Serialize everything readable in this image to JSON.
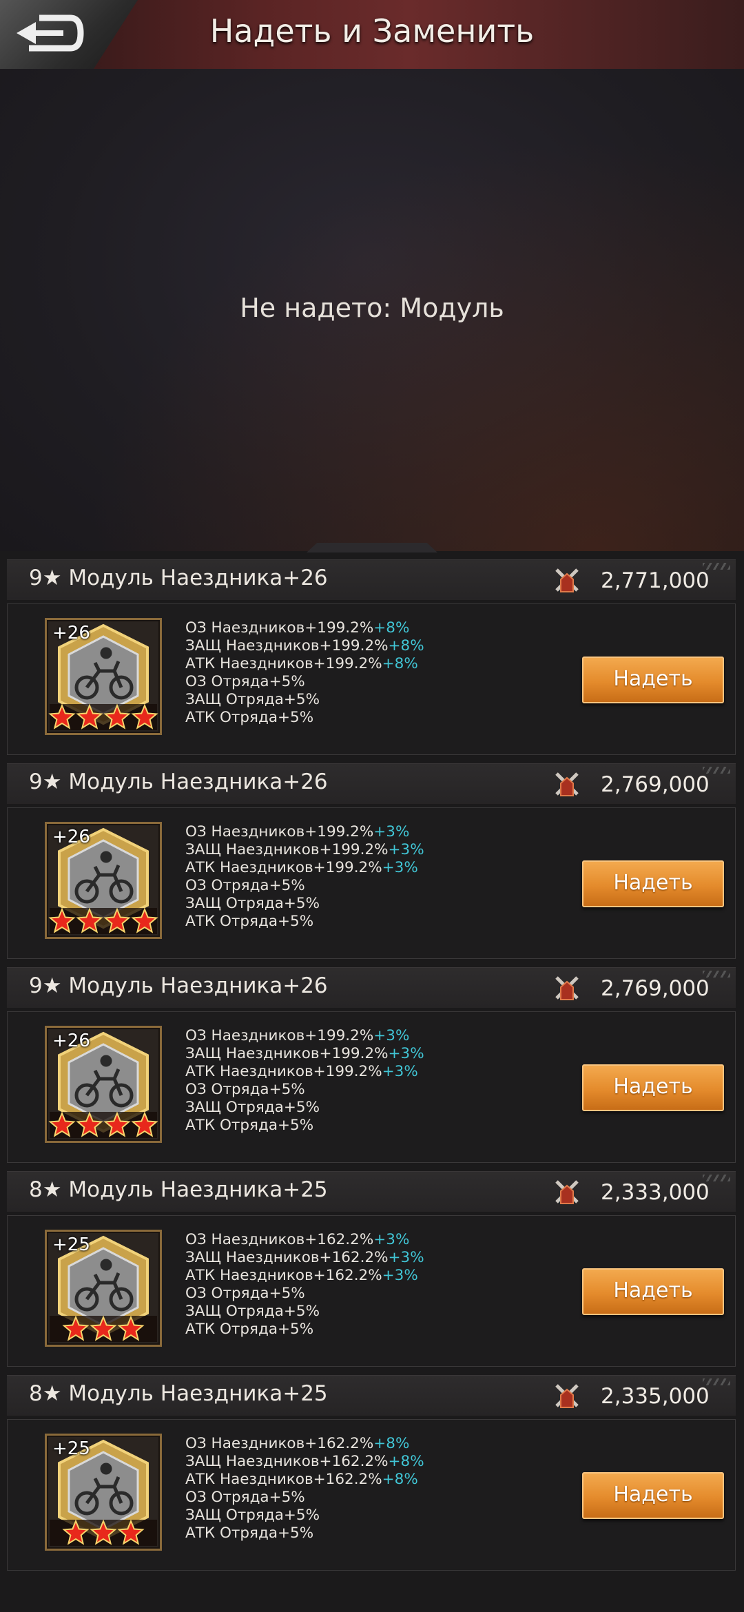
{
  "header": {
    "title": "Надеть и Заменить"
  },
  "preview": {
    "empty_text": "Не надето: Модуль"
  },
  "colors": {
    "accent": "#e48b2c",
    "bonus": "#41c6d6"
  },
  "items": [
    {
      "name": "9★ Модуль Наездника+26",
      "power": "2,771,000",
      "level": "+26",
      "stars": 4,
      "stats": [
        {
          "text": "ОЗ Наездников+199.2%",
          "bonus": "+8%"
        },
        {
          "text": "ЗАЩ Наездников+199.2%",
          "bonus": "+8%"
        },
        {
          "text": "АТК Наездников+199.2%",
          "bonus": "+8%"
        },
        {
          "text": "ОЗ Отряда+5%",
          "bonus": ""
        },
        {
          "text": "ЗАЩ Отряда+5%",
          "bonus": ""
        },
        {
          "text": "АТК Отряда+5%",
          "bonus": ""
        }
      ],
      "button": "Надеть"
    },
    {
      "name": "9★ Модуль Наездника+26",
      "power": "2,769,000",
      "level": "+26",
      "stars": 4,
      "stats": [
        {
          "text": "ОЗ Наездников+199.2%",
          "bonus": "+3%"
        },
        {
          "text": "ЗАЩ Наездников+199.2%",
          "bonus": "+3%"
        },
        {
          "text": "АТК Наездников+199.2%",
          "bonus": "+3%"
        },
        {
          "text": "ОЗ Отряда+5%",
          "bonus": ""
        },
        {
          "text": "ЗАЩ Отряда+5%",
          "bonus": ""
        },
        {
          "text": "АТК Отряда+5%",
          "bonus": ""
        }
      ],
      "button": "Надеть"
    },
    {
      "name": "9★ Модуль Наездника+26",
      "power": "2,769,000",
      "level": "+26",
      "stars": 4,
      "stats": [
        {
          "text": "ОЗ Наездников+199.2%",
          "bonus": "+3%"
        },
        {
          "text": "ЗАЩ Наездников+199.2%",
          "bonus": "+3%"
        },
        {
          "text": "АТК Наездников+199.2%",
          "bonus": "+3%"
        },
        {
          "text": "ОЗ Отряда+5%",
          "bonus": ""
        },
        {
          "text": "ЗАЩ Отряда+5%",
          "bonus": ""
        },
        {
          "text": "АТК Отряда+5%",
          "bonus": ""
        }
      ],
      "button": "Надеть"
    },
    {
      "name": "8★ Модуль Наездника+25",
      "power": "2,333,000",
      "level": "+25",
      "stars": 3,
      "stats": [
        {
          "text": "ОЗ Наездников+162.2%",
          "bonus": "+3%"
        },
        {
          "text": "ЗАЩ Наездников+162.2%",
          "bonus": "+3%"
        },
        {
          "text": "АТК Наездников+162.2%",
          "bonus": "+3%"
        },
        {
          "text": "ОЗ Отряда+5%",
          "bonus": ""
        },
        {
          "text": "ЗАЩ Отряда+5%",
          "bonus": ""
        },
        {
          "text": "АТК Отряда+5%",
          "bonus": ""
        }
      ],
      "button": "Надеть"
    },
    {
      "name": "8★ Модуль Наездника+25",
      "power": "2,335,000",
      "level": "+25",
      "stars": 3,
      "stats": [
        {
          "text": "ОЗ Наездников+162.2%",
          "bonus": "+8%"
        },
        {
          "text": "ЗАЩ Наездников+162.2%",
          "bonus": "+8%"
        },
        {
          "text": "АТК Наездников+162.2%",
          "bonus": "+8%"
        },
        {
          "text": "ОЗ Отряда+5%",
          "bonus": ""
        },
        {
          "text": "ЗАЩ Отряда+5%",
          "bonus": ""
        },
        {
          "text": "АТК Отряда+5%",
          "bonus": ""
        }
      ],
      "button": "Надеть"
    }
  ]
}
